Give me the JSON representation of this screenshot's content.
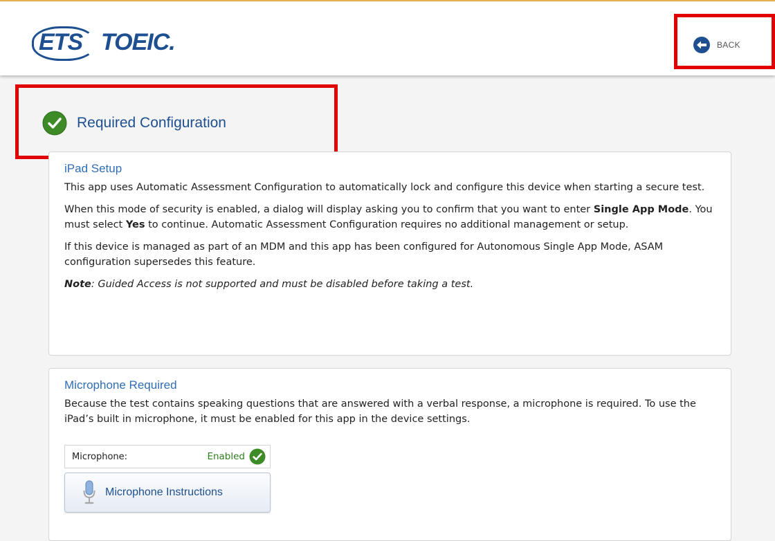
{
  "header": {
    "logo_ets": "ETS",
    "logo_toeic": "TOEIC.",
    "back_label": "BACK"
  },
  "section": {
    "title": "Required Configuration"
  },
  "ipad_setup": {
    "heading": "iPad Setup",
    "p1": "This app uses Automatic Assessment Configuration to automatically lock and configure this device when starting a secure test.",
    "p2_a": "When this mode of security is enabled, a dialog will display asking you to confirm that you want to enter ",
    "p2_b": "Single App Mode",
    "p2_c": ". You must select ",
    "p2_d": "Yes",
    "p2_e": " to continue. Automatic Assessment Configuration requires no additional management or setup.",
    "p3": "If this device is managed as part of an MDM and this app has been configured for Autonomous Single App Mode, ASAM configuration supersedes this feature.",
    "note_label": "Note",
    "note_text": ": Guided Access is not supported and must be disabled before taking a test."
  },
  "microphone": {
    "heading": "Microphone Required",
    "description": "Because the test contains speaking questions that are answered with a verbal response, a microphone is required. To use the iPad’s built in microphone, it must be enabled for this app in the device settings.",
    "row_label": "Microphone:",
    "status": "Enabled",
    "button_label": "Microphone Instructions"
  },
  "colors": {
    "brand_blue": "#1d4f91",
    "heading_blue": "#2f6db5",
    "success_green": "#3d8b27",
    "highlight_red": "#e00000",
    "top_accent": "#e9b44c"
  },
  "icons": [
    "back-arrow-icon",
    "check-circle-icon",
    "microphone-icon"
  ]
}
